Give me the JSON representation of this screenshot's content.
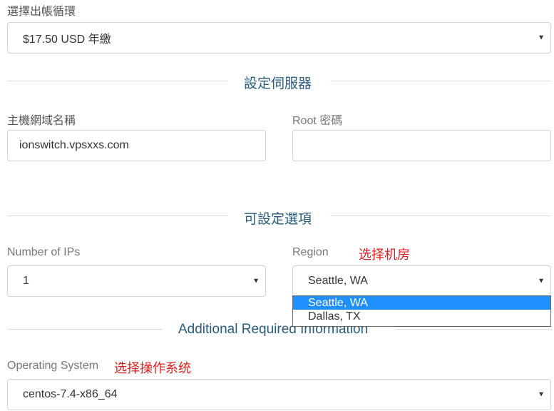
{
  "billing": {
    "label": "選擇出帳循環",
    "value": "$17.50 USD 年繳"
  },
  "server_section": {
    "title": "設定伺服器",
    "hostname_label": "主機網域名稱",
    "hostname_value": "ionswitch.vpsxxs.com",
    "root_label": "Root 密碼",
    "root_value": ""
  },
  "options_section": {
    "title": "可設定選項",
    "ips_label": "Number of IPs",
    "ips_value": "1",
    "region_label": "Region",
    "region_annotation": "选择机房",
    "region_value": "Seattle, WA",
    "region_options": [
      "Seattle, WA",
      "Dallas, TX"
    ],
    "region_selected_index": 0
  },
  "additional_section": {
    "title": "Additional Required Information",
    "os_label": "Operating System",
    "os_annotation": "选择操作系统",
    "os_value": "centos-7.4-x86_64"
  },
  "icons": {
    "caret": "caret-down-icon"
  }
}
